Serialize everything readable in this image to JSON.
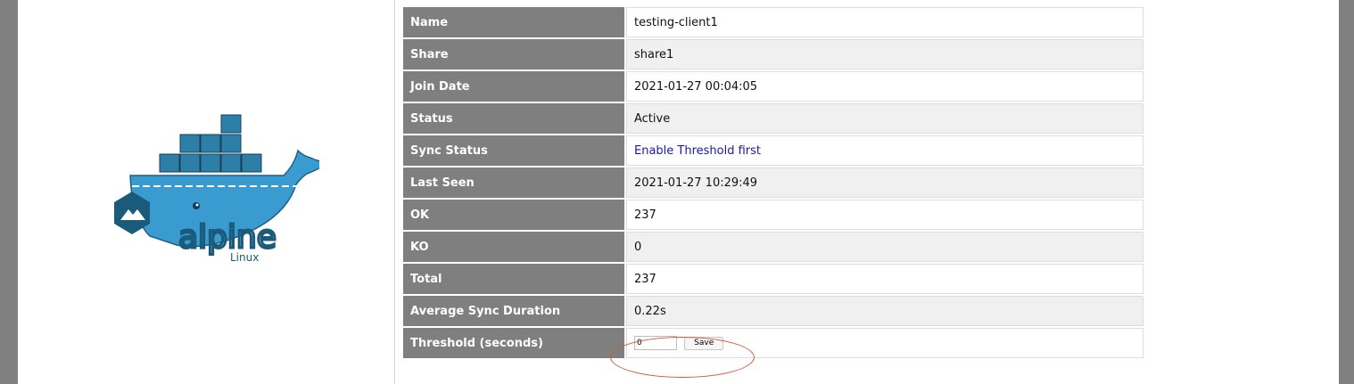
{
  "logo": {
    "word": "alpine",
    "subword": "Linux"
  },
  "details": [
    {
      "label": "Name",
      "value": "testing-client1"
    },
    {
      "label": "Share",
      "value": "share1"
    },
    {
      "label": "Join Date",
      "value": "2021-01-27 00:04:05"
    },
    {
      "label": "Status",
      "value": "Active"
    },
    {
      "label": "Sync Status",
      "value": "Enable Threshold first"
    },
    {
      "label": "Last Seen",
      "value": "2021-01-27 10:29:49"
    },
    {
      "label": "OK",
      "value": "237"
    },
    {
      "label": "KO",
      "value": "0"
    },
    {
      "label": "Total",
      "value": "237"
    },
    {
      "label": "Average Sync Duration",
      "value": "0.22s"
    },
    {
      "label": "Threshold (seconds)",
      "value": ""
    }
  ],
  "threshold": {
    "input_value": "0",
    "save_label": "Save"
  },
  "colors": {
    "label_bg": "#7f7f7f",
    "link": "#1a1aa6",
    "annotation": "#d9553e",
    "page_bg": "#808080"
  }
}
